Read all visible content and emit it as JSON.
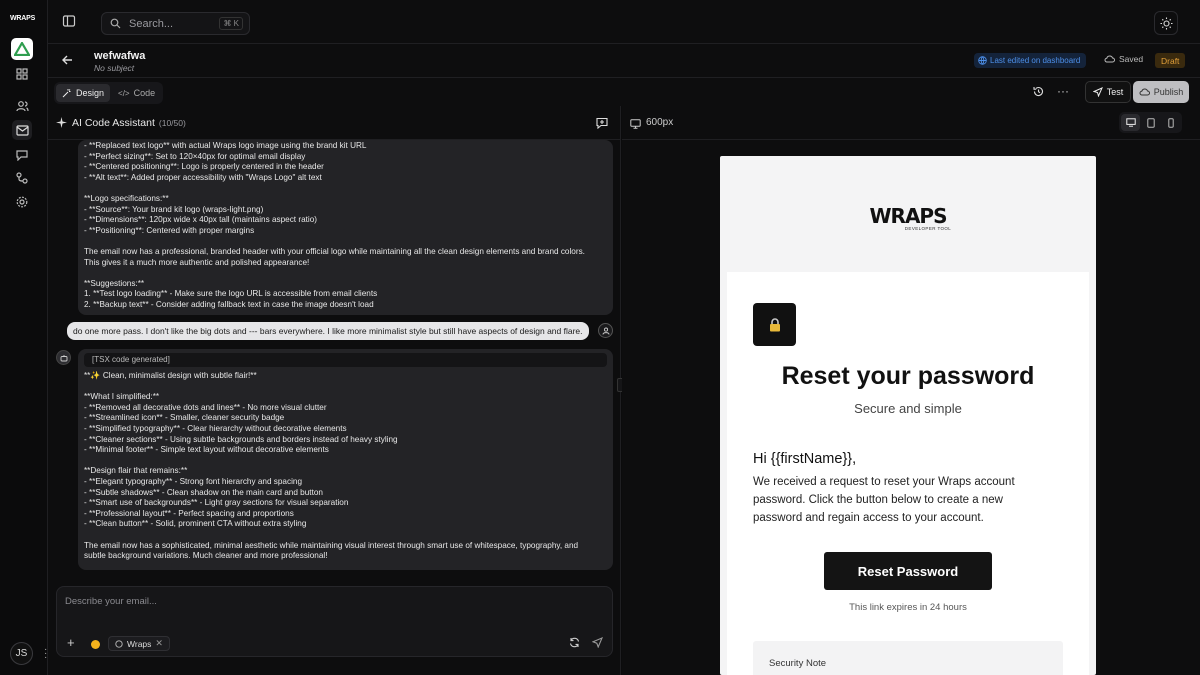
{
  "rail": {
    "brand": "WRAPS",
    "avatar_initials": "JS"
  },
  "topbar": {
    "search_placeholder": "Search...",
    "search_shortcut": "⌘ K"
  },
  "header": {
    "title": "wefwafwa",
    "subtitle": "No subject",
    "last_edited": "Last edited on dashboard",
    "saved": "Saved",
    "status": "Draft"
  },
  "toolbar": {
    "design_label": "Design",
    "code_label": "Code",
    "test_label": "Test",
    "publish_label": "Publish"
  },
  "chat": {
    "title": "AI Code Assistant",
    "counter": "(10/50)",
    "msg1_lines": [
      "- **Replaced text logo** with actual Wraps logo image using the brand kit URL",
      "- **Perfect sizing**: Set to 120×40px for optimal email display",
      "- **Centered positioning**: Logo is properly centered in the header",
      "- **Alt text**: Added proper accessibility with \"Wraps Logo\" alt text",
      "",
      "**Logo specifications:**",
      "- **Source**: Your brand kit logo (wraps-light.png)",
      "- **Dimensions**: 120px wide x 40px tall (maintains aspect ratio)",
      "- **Positioning**: Centered with proper margins",
      "",
      "The email now has a professional, branded header with your official logo while maintaining all the clean design elements and brand colors.",
      "This gives it a much more authentic and polished appearance!",
      "",
      "**Suggestions:**",
      "1. **Test logo loading** - Make sure the logo URL is accessible from email clients",
      "2. **Backup text** - Consider adding fallback text in case the image doesn't load"
    ],
    "user_msg": "do one more pass. I don't like the big dots and --- bars everywhere. I like more minimalist style but still have aspects of design and flare.",
    "tsx_tag": "[TSX code generated]",
    "msg2_lines": [
      "**✨ Clean, minimalist design with subtle flair!**",
      "",
      "**What I simplified:**",
      "- **Removed all decorative dots and lines** - No more visual clutter",
      "- **Streamlined icon** - Smaller, cleaner security badge",
      "- **Simplified typography** - Clear hierarchy without decorative elements",
      "- **Cleaner sections** - Using subtle backgrounds and borders instead of heavy styling",
      "- **Minimal footer** - Simple text layout without decorative elements",
      "",
      "**Design flair that remains:**",
      "- **Elegant typography** - Strong font hierarchy and spacing",
      "- **Subtle shadows** - Clean shadow on the main card and button",
      "- **Smart use of backgrounds** - Light gray sections for visual separation",
      "- **Professional layout** - Perfect spacing and proportions",
      "- **Clean button** - Solid, prominent CTA without extra styling",
      "",
      "The email now has a sophisticated, minimal aesthetic while maintaining visual interest through smart use of whitespace, typography, and",
      "subtle background variations. Much cleaner and more professional!"
    ],
    "composer_placeholder": "Describe your email...",
    "chip_label": "Wraps"
  },
  "preview": {
    "width_label": "600px",
    "email": {
      "logo_wordmark": "WRAPS",
      "logo_tagline": "DEVELOPER TOOL",
      "heading": "Reset your password",
      "subheading": "Secure and simple",
      "greeting": "Hi {{firstName}},",
      "body": "We received a request to reset your Wraps account password. Click the button below to create a new password and regain access to your account.",
      "cta": "Reset Password",
      "expiry": "This link expires in 24 hours",
      "note_title": "Security Note"
    }
  },
  "colors": {
    "accent_blue": "#4d8fe8",
    "draft_amber": "#e2a03a",
    "brand_green": "#2f9e4f"
  }
}
